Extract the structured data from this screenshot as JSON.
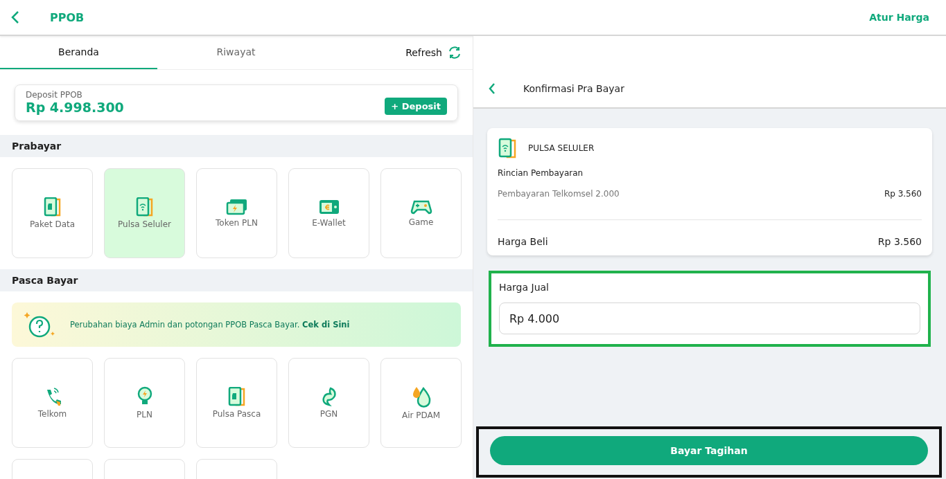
{
  "header": {
    "title": "PPOB",
    "action": "Atur Harga"
  },
  "tabs": [
    {
      "label": "Beranda",
      "selected": true
    },
    {
      "label": "Riwayat",
      "selected": false
    }
  ],
  "refresh": {
    "label": "Refresh"
  },
  "deposit": {
    "label": "Deposit PPOB",
    "amount": "Rp 4.998.300",
    "button": "+ Deposit"
  },
  "prabayar": {
    "title": "Prabayar",
    "items": [
      {
        "label": "Paket Data",
        "selected": false
      },
      {
        "label": "Pulsa Seluler",
        "selected": true
      },
      {
        "label": "Token PLN",
        "selected": false
      },
      {
        "label": "E-Wallet",
        "selected": false
      },
      {
        "label": "Game",
        "selected": false
      }
    ]
  },
  "pasca": {
    "title": "Pasca Bayar",
    "notice": "Perubahan biaya Admin dan potongan PPOB Pasca Bayar. **Cek di Sini**",
    "items": [
      {
        "label": "Telkom",
        "selected": false
      },
      {
        "label": "PLN",
        "selected": false
      },
      {
        "label": "Pulsa Pasca",
        "selected": false
      },
      {
        "label": "PGN",
        "selected": false
      },
      {
        "label": "Air PDAM",
        "selected": false
      },
      {
        "cut_off": true
      },
      {
        "cut_off": true
      },
      {
        "cut_off": true
      }
    ]
  },
  "confirm": {
    "title": "Konfirmasi Pra Bayar",
    "product": "PULSA SELULER",
    "details_title": "Rincian Pembayaran",
    "line_label": "Pembayaran Telkomsel 2.000",
    "line_value": "Rp 3.560",
    "buy_label": "Harga Beli",
    "buy_value": "Rp 3.560",
    "sell_label": "Harga Jual",
    "sell_value": "Rp 4.000",
    "pay_button": "Bayar Tagihan"
  }
}
